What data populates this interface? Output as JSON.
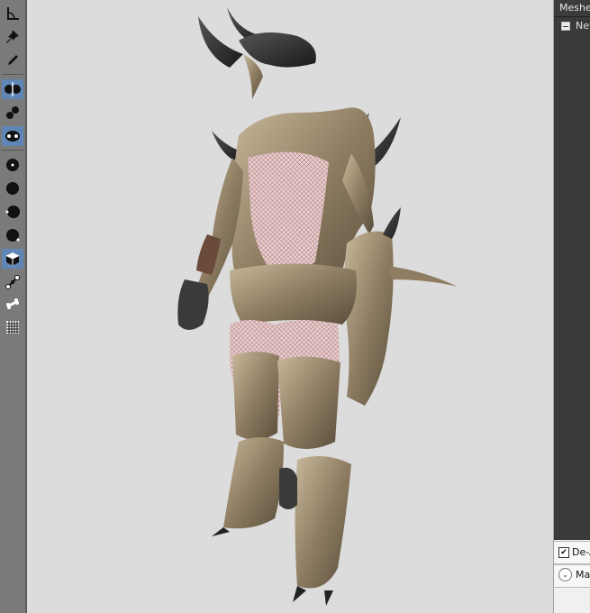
{
  "toolbar": {
    "tools": [
      {
        "name": "select-tool-icon",
        "active": false
      },
      {
        "name": "pin-tool-icon",
        "active": false
      },
      {
        "name": "pencil-tool-icon",
        "active": false
      },
      {
        "name": "mirror-tool-icon",
        "active": true
      },
      {
        "name": "move-brush-icon",
        "active": false
      },
      {
        "name": "inflate-brush-icon",
        "active": true
      },
      {
        "name": "smooth-brush-icon",
        "active": false
      },
      {
        "name": "deflate-brush-icon",
        "active": false
      },
      {
        "name": "push-brush-icon",
        "active": false
      },
      {
        "name": "falloff-brush-icon",
        "active": false
      },
      {
        "name": "mask-cube-icon",
        "active": true
      },
      {
        "name": "bone-weight-icon",
        "active": false
      },
      {
        "name": "bone-icon",
        "active": false
      },
      {
        "name": "grid-icon",
        "active": false
      }
    ]
  },
  "right_panel": {
    "meshes_header": "Meshes",
    "tree_item": "New",
    "deform_label": "De-A",
    "deform_checked": true,
    "mask_label": "Ma"
  },
  "colors": {
    "viewport_bg": "#dcdcdc",
    "toolbar_bg": "#7a7a7a",
    "active_tool": "#5f86b4",
    "tree_bg": "#3a3a3a"
  }
}
